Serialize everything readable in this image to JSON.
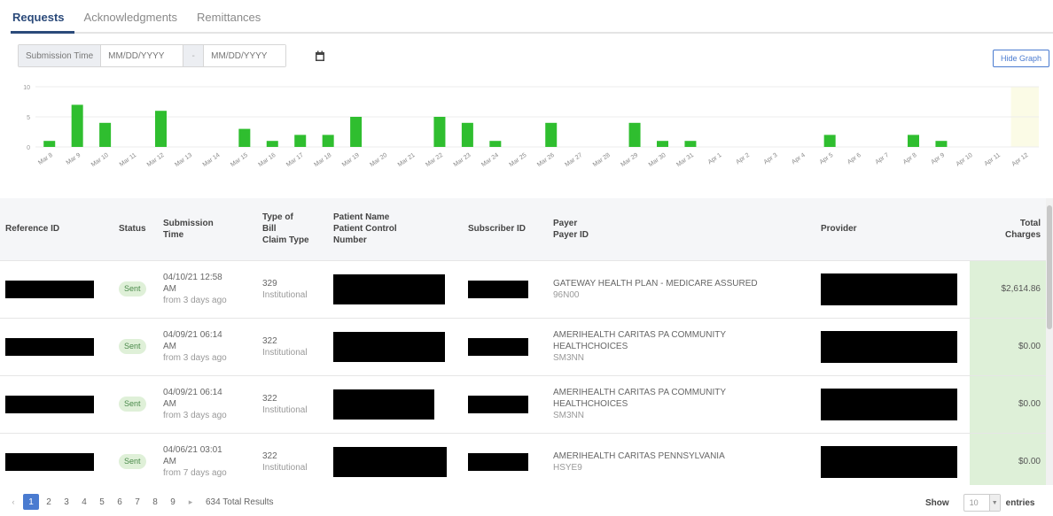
{
  "tabs": [
    {
      "label": "Requests",
      "active": true
    },
    {
      "label": "Acknowledgments",
      "active": false
    },
    {
      "label": "Remittances",
      "active": false
    }
  ],
  "filter": {
    "label": "Submission Time",
    "from_placeholder": "MM/DD/YYYY",
    "separator": "-",
    "to_placeholder": "MM/DD/YYYY",
    "calendar_icon": "calendar-icon"
  },
  "hide_graph_label": "Hide Graph",
  "chart_data": {
    "type": "bar",
    "color": "#2fbe2f",
    "highlight_color": "#fbfbe6",
    "highlight_category": "Apr 12",
    "ylim": [
      0,
      10
    ],
    "y_ticks": [
      "0",
      "5",
      "10"
    ],
    "categories": [
      "Mar 8",
      "Mar 9",
      "Mar 10",
      "Mar 11",
      "Mar 12",
      "Mar 13",
      "Mar 14",
      "Mar 15",
      "Mar 16",
      "Mar 17",
      "Mar 18",
      "Mar 19",
      "Mar 20",
      "Mar 21",
      "Mar 22",
      "Mar 23",
      "Mar 24",
      "Mar 25",
      "Mar 26",
      "Mar 27",
      "Mar 28",
      "Mar 29",
      "Mar 30",
      "Mar 31",
      "Apr 1",
      "Apr 2",
      "Apr 3",
      "Apr 4",
      "Apr 5",
      "Apr 6",
      "Apr 7",
      "Apr 8",
      "Apr 9",
      "Apr 10",
      "Apr 11",
      "Apr 12"
    ],
    "values": [
      1,
      7,
      4,
      0,
      6,
      0,
      0,
      3,
      1,
      2,
      2,
      5,
      0,
      0,
      5,
      4,
      1,
      0,
      4,
      0,
      0,
      4,
      1,
      1,
      0,
      0,
      0,
      0,
      2,
      0,
      0,
      2,
      1,
      0,
      0,
      0
    ],
    "grid": true
  },
  "table": {
    "headers": [
      {
        "line1": "Reference ID",
        "line2": "",
        "line3": "",
        "align": "left"
      },
      {
        "line1": "Status",
        "line2": "",
        "line3": "",
        "align": "left"
      },
      {
        "line1": "Submission",
        "line2": "Time",
        "line3": "",
        "align": "left"
      },
      {
        "line1": "Type of",
        "line2": "Bill",
        "line3": "Claim Type",
        "align": "left"
      },
      {
        "line1": "Patient Name",
        "line2": "Patient Control",
        "line3": "Number",
        "align": "left"
      },
      {
        "line1": "Subscriber ID",
        "line2": "",
        "line3": "",
        "align": "left"
      },
      {
        "line1": "Payer",
        "line2": "Payer ID",
        "line3": "",
        "align": "left"
      },
      {
        "line1": "Provider",
        "line2": "",
        "line3": "",
        "align": "left"
      },
      {
        "line1": "Total",
        "line2": "Charges",
        "line3": "",
        "align": "right"
      }
    ],
    "rows": [
      {
        "status": "Sent",
        "time1": "04/10/21 12:58",
        "time2": "AM",
        "ago": "from 3 days ago",
        "bill": "329",
        "claim": "Institutional",
        "payer1": "GATEWAY HEALTH PLAN - MEDICARE ASSURED",
        "payer2": "",
        "payer_id": "96N00",
        "charges": "$2,614.86"
      },
      {
        "status": "Sent",
        "time1": "04/09/21 06:14",
        "time2": "AM",
        "ago": "from 3 days ago",
        "bill": "322",
        "claim": "Institutional",
        "payer1": "AMERIHEALTH CARITAS PA COMMUNITY",
        "payer2": "HEALTHCHOICES",
        "payer_id": "SM3NN",
        "charges": "$0.00"
      },
      {
        "status": "Sent",
        "time1": "04/09/21 06:14",
        "time2": "AM",
        "ago": "from 3 days ago",
        "bill": "322",
        "claim": "Institutional",
        "payer1": "AMERIHEALTH CARITAS PA COMMUNITY",
        "payer2": "HEALTHCHOICES",
        "payer_id": "SM3NN",
        "charges": "$0.00"
      },
      {
        "status": "Sent",
        "time1": "04/06/21 03:01",
        "time2": "AM",
        "ago": "from 7 days ago",
        "bill": "322",
        "claim": "Institutional",
        "payer1": "AMERIHEALTH CARITAS PENNSYLVANIA",
        "payer2": "",
        "payer_id": "HSYE9",
        "charges": "$0.00"
      }
    ]
  },
  "pagination": {
    "prev": "‹",
    "pages": [
      "1",
      "2",
      "3",
      "4",
      "5",
      "6",
      "7",
      "8",
      "9"
    ],
    "active_page": "1",
    "next": "▸",
    "total": "634 Total Results"
  },
  "show": {
    "label": "Show",
    "value": "10",
    "entries_label": "entries"
  }
}
